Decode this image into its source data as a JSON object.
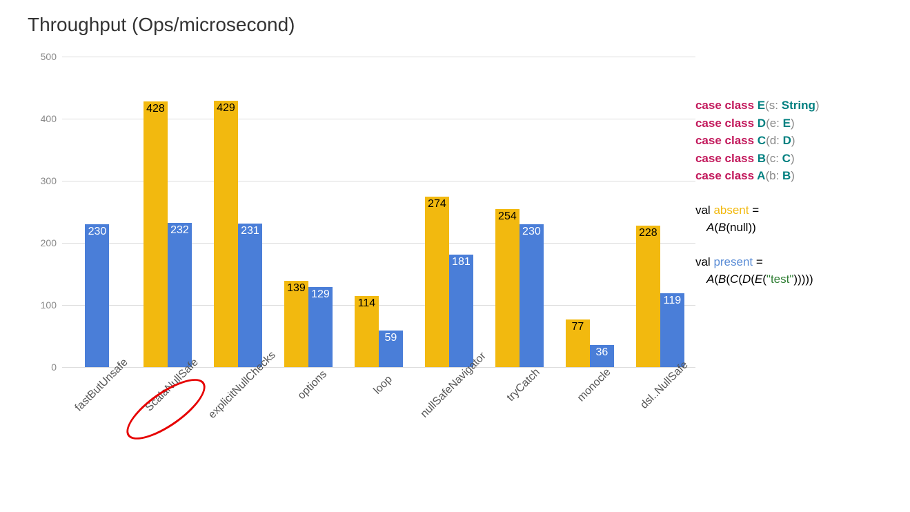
{
  "chart_data": {
    "type": "bar",
    "title": "Throughput (Ops/microsecond)",
    "xlabel": "",
    "ylabel": "",
    "ylim": [
      0,
      500
    ],
    "yticks": [
      0,
      100,
      200,
      300,
      400,
      500
    ],
    "categories": [
      "fastButUnsafe",
      "ScalaNullSafe",
      "explicitNullChecks",
      "options",
      "loop",
      "nullSafeNavigator",
      "tryCatch",
      "monocle",
      "dsl..NullSafe"
    ],
    "series": [
      {
        "name": "absent",
        "color": "#f2b90f",
        "values": [
          null,
          428,
          429,
          139,
          114,
          274,
          254,
          77,
          228
        ]
      },
      {
        "name": "present",
        "color": "#4a7ed8",
        "values": [
          230,
          232,
          231,
          129,
          59,
          181,
          230,
          36,
          119
        ]
      }
    ],
    "highlight_category": "ScalaNullSafe"
  },
  "code": {
    "classes": [
      {
        "name": "E",
        "param": "s",
        "ptype": "String"
      },
      {
        "name": "D",
        "param": "e",
        "ptype": "E"
      },
      {
        "name": "C",
        "param": "d",
        "ptype": "D"
      },
      {
        "name": "B",
        "param": "c",
        "ptype": "C"
      },
      {
        "name": "A",
        "param": "b",
        "ptype": "B"
      }
    ],
    "absent_label": "absent",
    "absent_expr_prefix": "A",
    "absent_expr_inner": "B",
    "absent_null": "null",
    "present_label": "present",
    "present_chain": [
      "A",
      "B",
      "C",
      "D",
      "E"
    ],
    "present_literal": "\"test\"",
    "val_kw": "val",
    "caseclass_kw": "case class",
    "equals": " ="
  }
}
